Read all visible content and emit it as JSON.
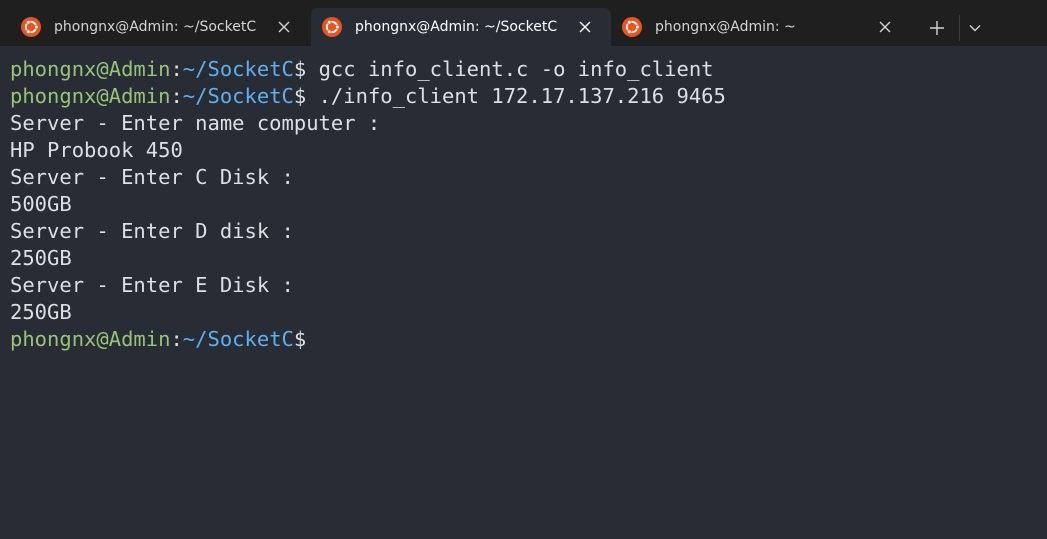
{
  "tabs": [
    {
      "title": "phongnx@Admin: ~/SocketC",
      "active": false,
      "icon": "ubuntu-icon"
    },
    {
      "title": "phongnx@Admin: ~/SocketC",
      "active": true,
      "icon": "ubuntu-icon"
    },
    {
      "title": "phongnx@Admin: ~",
      "active": false,
      "icon": "ubuntu-icon"
    }
  ],
  "controls": {
    "new_tab": "plus-icon",
    "dropdown": "chevron-down-icon"
  },
  "colors": {
    "tab_bar": "#1f1f1f",
    "terminal_bg": "#282c34",
    "prompt_user": "#98c379",
    "prompt_path": "#61afef",
    "text": "#dcdfe4",
    "ubuntu_orange": "#e95420"
  },
  "terminal": {
    "prompt_user": "phongnx@Admin",
    "prompt_colon": ":",
    "prompt_path": "~/SocketC",
    "prompt_symbol": "$",
    "lines": [
      {
        "type": "prompt",
        "command": " gcc info_client.c -o info_client"
      },
      {
        "type": "prompt",
        "command": " ./info_client 172.17.137.216 9465"
      },
      {
        "type": "output",
        "text": "Server - Enter name computer :"
      },
      {
        "type": "output",
        "text": "HP Probook 450"
      },
      {
        "type": "output",
        "text": "Server - Enter C Disk :"
      },
      {
        "type": "output",
        "text": "500GB"
      },
      {
        "type": "output",
        "text": "Server - Enter D disk :"
      },
      {
        "type": "output",
        "text": "250GB"
      },
      {
        "type": "output",
        "text": "Server - Enter E Disk :"
      },
      {
        "type": "output",
        "text": "250GB"
      },
      {
        "type": "prompt",
        "command": ""
      }
    ]
  }
}
